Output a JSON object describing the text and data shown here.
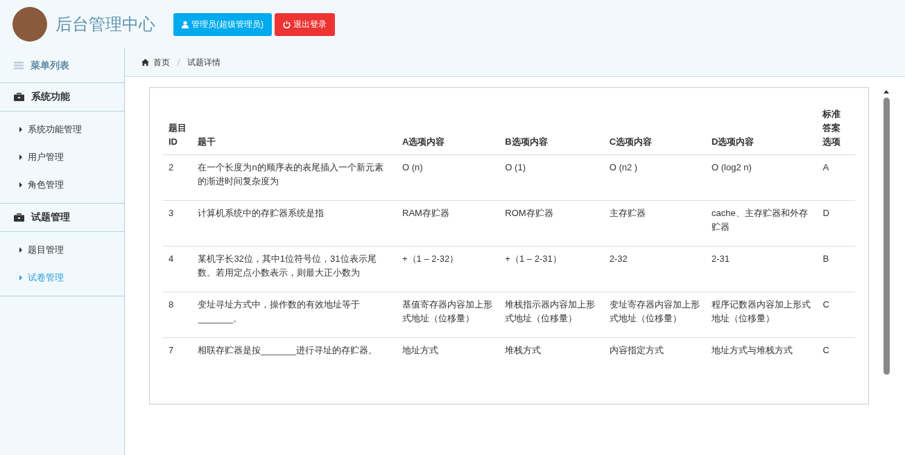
{
  "header": {
    "title": "后台管理中心",
    "buttons": [
      {
        "kind": "user",
        "label": "管理员(超级管理员)"
      },
      {
        "kind": "logout",
        "label": "退出登录"
      }
    ]
  },
  "sidebar": {
    "heading": "菜单列表",
    "groups": [
      {
        "label": "系统功能",
        "items": [
          {
            "label": "系统功能管理",
            "selected": false
          },
          {
            "label": "用户管理",
            "selected": false
          },
          {
            "label": "角色管理",
            "selected": false
          }
        ]
      },
      {
        "label": "试题管理",
        "items": [
          {
            "label": "题目管理",
            "selected": false
          },
          {
            "label": "试卷管理",
            "selected": true
          }
        ]
      }
    ]
  },
  "breadcrumb": [
    "首页",
    "试题详情"
  ],
  "table": {
    "columns": [
      "题目ID",
      "题干",
      "A选项内容",
      "B选项内容",
      "C选项内容",
      "D选项内容",
      "标准答案选项"
    ],
    "rows": [
      [
        "2",
        "在一个长度为n的顺序表的表尾插入一个新元素的渐进时间复杂度为",
        "O (n)",
        "O (1)",
        "O (n2 )",
        "O (log2 n)",
        "A"
      ],
      [
        "3",
        "计算机系统中的存贮器系统是指",
        "RAM存贮器",
        "ROM存贮器",
        "主存贮器",
        "cache、主存贮器和外存贮器",
        "D"
      ],
      [
        "4",
        "某机字长32位，其中1位符号位，31位表示尾数。若用定点小数表示，则最大正小数为",
        "+（1 – 2-32）",
        "+（1 – 2-31）",
        "2-32",
        "2-31",
        "B"
      ],
      [
        "8",
        "变址寻址方式中，操作数的有效地址等于_______。",
        "基值寄存器内容加上形式地址（位移量）",
        "堆栈指示器内容加上形式地址（位移量）",
        "变址寄存器内容加上形式地址（位移量）",
        "程序记数器内容加上形式地址（位移量）",
        "C"
      ],
      [
        "7",
        "相联存贮器是按_______进行寻址的存贮器。",
        "地址方式",
        "堆栈方式",
        "内容指定方式",
        "地址方式与堆栈方式",
        "C"
      ]
    ]
  }
}
